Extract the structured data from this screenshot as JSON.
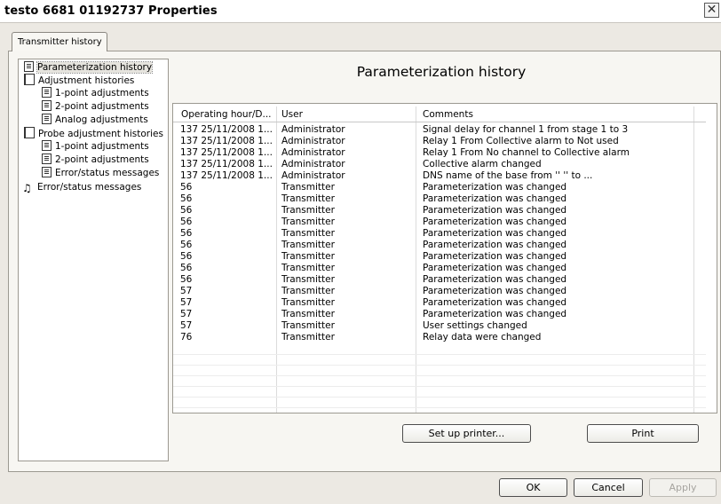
{
  "window": {
    "title": "testo 6681  01192737 Properties",
    "close_icon": "close-icon"
  },
  "tabs": [
    {
      "label": "Transmitter history"
    }
  ],
  "tree": {
    "items": [
      {
        "label": "Parameterization history",
        "icon": "history-doc-icon",
        "selected": true
      },
      {
        "label": "Adjustment histories",
        "icon": "folder-icon"
      },
      {
        "label": "1-point adjustments",
        "icon": "history-doc-icon"
      },
      {
        "label": "2-point adjustments",
        "icon": "history-doc-icon"
      },
      {
        "label": "Analog adjustments",
        "icon": "history-doc-icon"
      },
      {
        "label": "Probe adjustment histories",
        "icon": "folder-icon"
      },
      {
        "label": "1-point adjustments",
        "icon": "history-doc-icon"
      },
      {
        "label": "2-point adjustments",
        "icon": "history-doc-icon"
      },
      {
        "label": "Error/status messages",
        "icon": "history-doc-icon"
      },
      {
        "label": "Error/status messages",
        "icon": "alarm-bell-icon"
      }
    ]
  },
  "main": {
    "title": "Parameterization history",
    "columns": [
      "Operating hour/D...",
      "User",
      "Comments"
    ],
    "rows": [
      [
        "137 25/11/2008 1...",
        "Administrator",
        "Signal delay for channel 1 from stage 1 to 3"
      ],
      [
        "137 25/11/2008 1...",
        "Administrator",
        "Relay 1 From Collective alarm to Not used"
      ],
      [
        "137 25/11/2008 1...",
        "Administrator",
        "Relay 1 From No channel to Collective alarm"
      ],
      [
        "137 25/11/2008 1...",
        "Administrator",
        "Collective alarm changed"
      ],
      [
        "137 25/11/2008 1...",
        "Administrator",
        "DNS name of the base from ''                                    '' to ..."
      ],
      [
        "56",
        "Transmitter",
        "Parameterization was changed"
      ],
      [
        "56",
        "Transmitter",
        "Parameterization was changed"
      ],
      [
        "56",
        "Transmitter",
        "Parameterization was changed"
      ],
      [
        "56",
        "Transmitter",
        "Parameterization was changed"
      ],
      [
        "56",
        "Transmitter",
        "Parameterization was changed"
      ],
      [
        "56",
        "Transmitter",
        "Parameterization was changed"
      ],
      [
        "56",
        "Transmitter",
        "Parameterization was changed"
      ],
      [
        "56",
        "Transmitter",
        "Parameterization was changed"
      ],
      [
        "56",
        "Transmitter",
        "Parameterization was changed"
      ],
      [
        "57",
        "Transmitter",
        "Parameterization was changed"
      ],
      [
        "57",
        "Transmitter",
        "Parameterization was changed"
      ],
      [
        "57",
        "Transmitter",
        "Parameterization was changed"
      ],
      [
        "57",
        "Transmitter",
        "User settings changed"
      ],
      [
        "76",
        "Transmitter",
        "Relay data were changed"
      ]
    ],
    "setup_printer_label": "Set up printer...",
    "print_label": "Print"
  },
  "footer": {
    "ok_label": "OK",
    "cancel_label": "Cancel",
    "apply_label": "Apply"
  }
}
